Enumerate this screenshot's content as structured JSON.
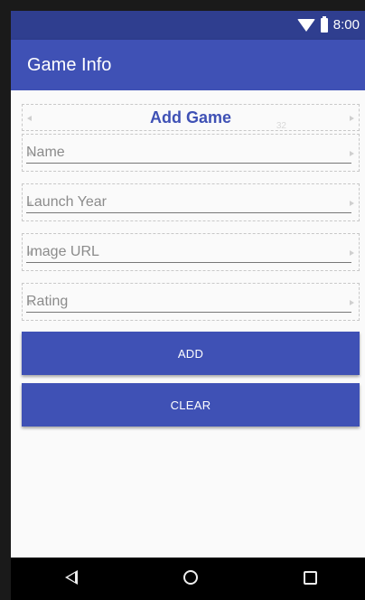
{
  "status_bar": {
    "time": "8:00",
    "icons": [
      "wifi-icon",
      "battery-icon"
    ]
  },
  "app_bar": {
    "title": "Game Info"
  },
  "form": {
    "heading": "Add Game",
    "heading_constraint": "32",
    "fields": [
      {
        "name": "name",
        "placeholder": "Name",
        "value": ""
      },
      {
        "name": "launch-year",
        "placeholder": "Launch Year",
        "value": ""
      },
      {
        "name": "image-url",
        "placeholder": "Image URL",
        "value": ""
      },
      {
        "name": "rating",
        "placeholder": "Rating",
        "value": ""
      }
    ],
    "buttons": {
      "add": "ADD",
      "clear": "CLEAR"
    }
  },
  "nav_bar": {
    "icons": [
      "back-icon",
      "home-icon",
      "recent-apps-icon"
    ]
  },
  "colors": {
    "status_bar": "#2f3e8f",
    "primary": "#3f51b5",
    "background": "#fafafa",
    "nav_bar": "#000000"
  }
}
